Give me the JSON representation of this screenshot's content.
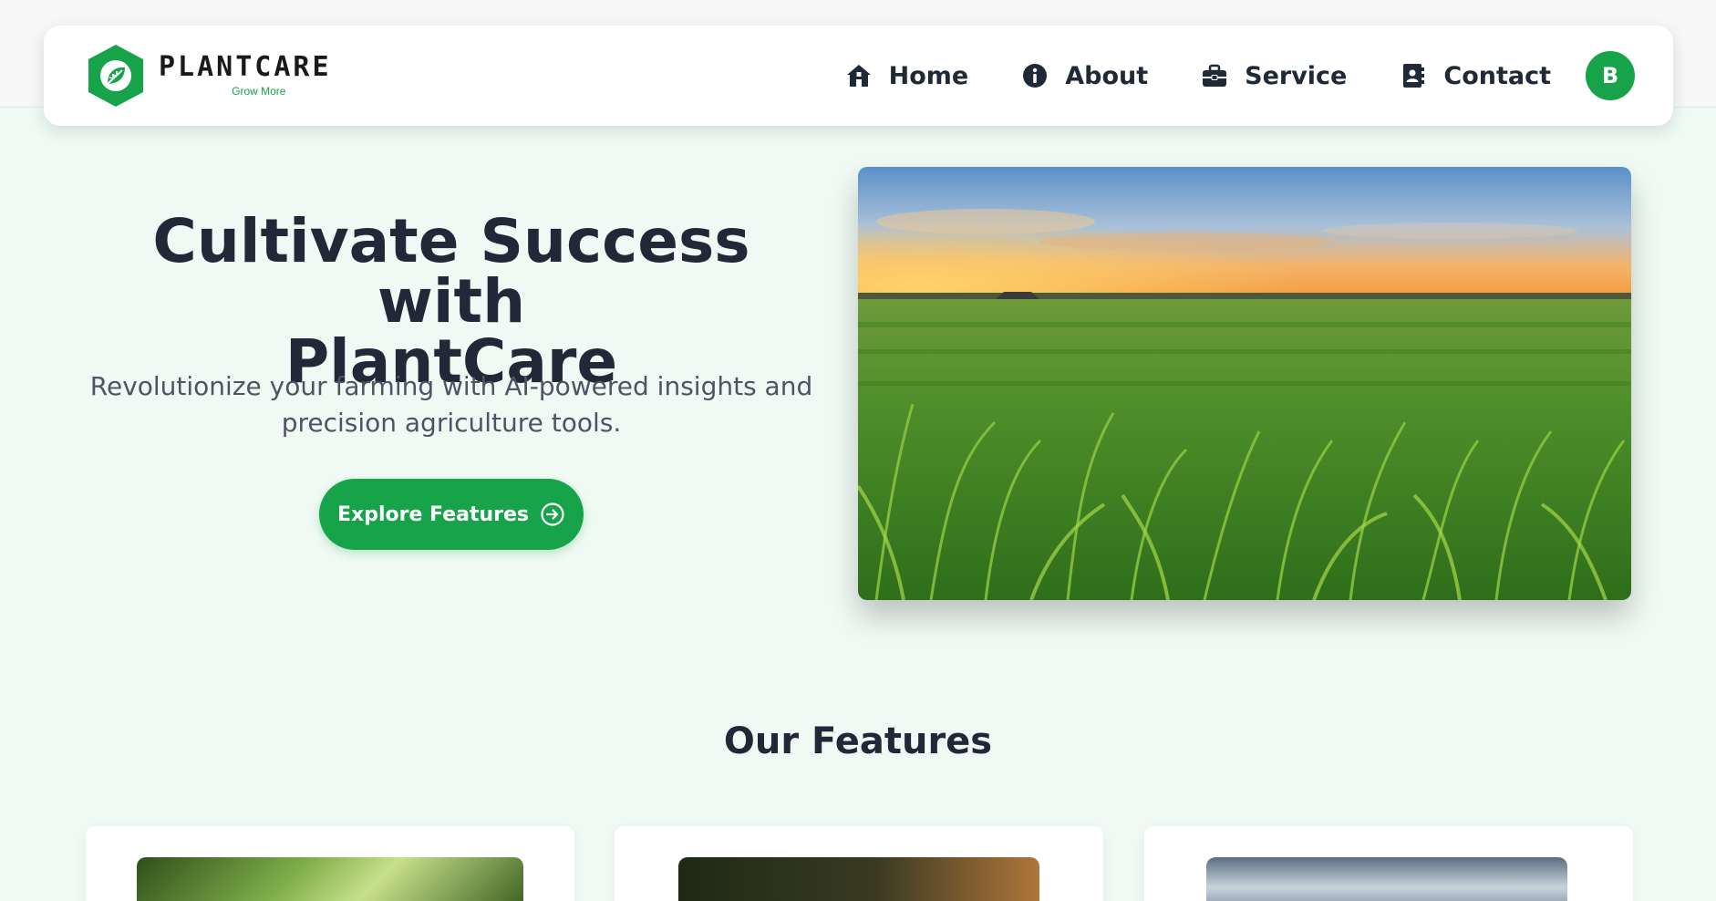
{
  "brand": {
    "name": "PLANTCARE",
    "tagline": "Grow More",
    "accent_color": "#16a34a"
  },
  "nav": {
    "items": [
      {
        "label": "Home",
        "icon": "home-icon"
      },
      {
        "label": "About",
        "icon": "info-icon"
      },
      {
        "label": "Service",
        "icon": "briefcase-icon"
      },
      {
        "label": "Contact",
        "icon": "contact-book-icon"
      }
    ],
    "avatar_initial": "B"
  },
  "hero": {
    "title_line1": "Cultivate Success with",
    "title_line2": "PlantCare",
    "subtitle_line1": "Revolutionize your farming with AI-powered insights and",
    "subtitle_line2": "precision agriculture tools.",
    "cta_label": "Explore Features",
    "cta_icon": "arrow-circle-right-icon",
    "image": "cornfield-sunset-photo"
  },
  "features": {
    "title": "Our Features",
    "cards": [
      {
        "image": "leaves-photo"
      },
      {
        "image": "dark-soil-photo"
      },
      {
        "image": "cloudy-sky-photo"
      }
    ]
  }
}
